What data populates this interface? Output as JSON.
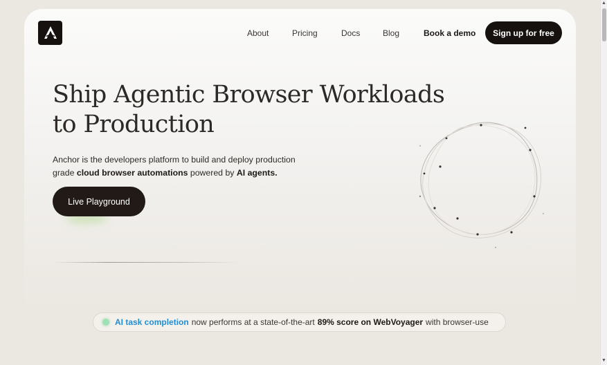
{
  "nav": {
    "links": [
      "About",
      "Pricing",
      "Docs",
      "Blog"
    ],
    "book_demo": "Book a demo",
    "signup": "Sign up for free"
  },
  "hero": {
    "title_line1": "Ship Agentic Browser Workloads",
    "title_line2": "to Production",
    "desc_part1": "Anchor is the developers platform to build and deploy production grade ",
    "desc_bold1": "cloud browser automations",
    "desc_part2": " powered by ",
    "desc_bold2": "AI agents.",
    "cta": "Live Playground"
  },
  "announcement": {
    "link": "AI task completion",
    "text1": "now performs at a state-of-the-art",
    "strong": "89% score on WebVoyager",
    "text2": "with browser-use"
  },
  "colors": {
    "background": "#ebe7e1",
    "button_dark": "#16110f",
    "link_blue": "#1e8fd6",
    "status_green": "#9fe0b4"
  },
  "icons": {
    "logo": "anchor-logo",
    "scroll_up": "arrow-up",
    "scroll_down": "arrow-down"
  }
}
